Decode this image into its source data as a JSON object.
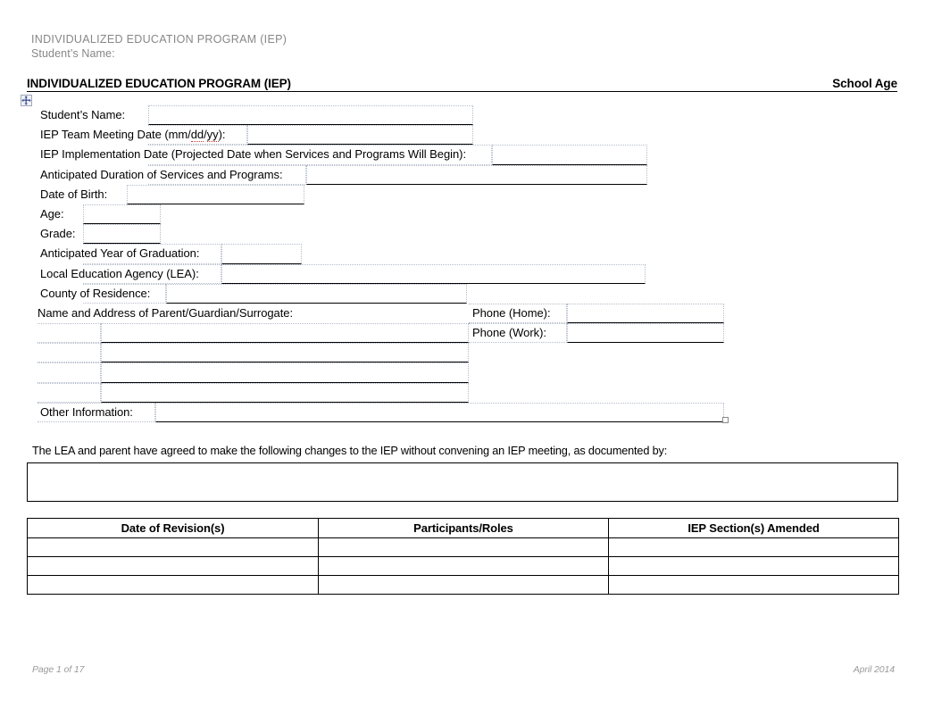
{
  "running_header": {
    "title": "INDIVIDUALIZED  EDUCATION  PROGRAM (IEP)",
    "student_name_label": "Student’s  Name:"
  },
  "title_bar": {
    "left": "INDIVIDUALIZED EDUCATION PROGRAM (IEP)",
    "right": "School Age"
  },
  "icons": {
    "table_move_handle": "table-move-handle-icon",
    "table_resize_handle": "table-resize-handle-icon"
  },
  "form": {
    "student_name_label": "Student’s  Name:",
    "student_name_value": "",
    "meeting_date_label_a": "IEP Team Meeting  Date (mm/",
    "meeting_date_label_dd": "dd",
    "meeting_date_label_slash": "/",
    "meeting_date_label_yy": "yy",
    "meeting_date_label_b": "):",
    "meeting_date_value": "",
    "implementation_date_label": "IEP Implementation  Date (Projected  Date when Services  and Programs Will Begin):",
    "implementation_date_value": "",
    "duration_label": "Anticipated  Duration  of Services  and Programs:",
    "duration_value": "",
    "dob_label": "Date of Birth:",
    "dob_value": "",
    "age_label": "Age:",
    "age_value": "",
    "grade_label": "Grade:",
    "grade_value": "",
    "graduation_label": "Anticipated  Year of Graduation:",
    "graduation_value": "",
    "lea_label": "Local Education  Agency (LEA):",
    "lea_value": "",
    "county_label": "County  of Residence:",
    "county_value": "",
    "parent_label": "Name and Address of Parent/Guardian/Surrogate:",
    "parent_line1": "",
    "parent_line2": "",
    "parent_line3": "",
    "parent_line4": "",
    "phone_home_label": "Phone (Home):",
    "phone_home_value": "",
    "phone_work_label": "Phone (Work):",
    "phone_work_value": "",
    "other_info_label": "Other Information:",
    "other_info_value": ""
  },
  "agreement": {
    "text": "The LEA and parent have agreed to make the following changes to the IEP without  convening  an IEP meeting,  as documented  by:",
    "box_value": ""
  },
  "revisions_table": {
    "headers": [
      "Date of Revision(s)",
      "Participants/Roles",
      "IEP Section(s) Amended"
    ],
    "rows": [
      [
        "",
        "",
        ""
      ],
      [
        "",
        "",
        ""
      ],
      [
        "",
        "",
        ""
      ]
    ]
  },
  "footer": {
    "page": "Page 1 of 17",
    "date": "April 2014"
  }
}
